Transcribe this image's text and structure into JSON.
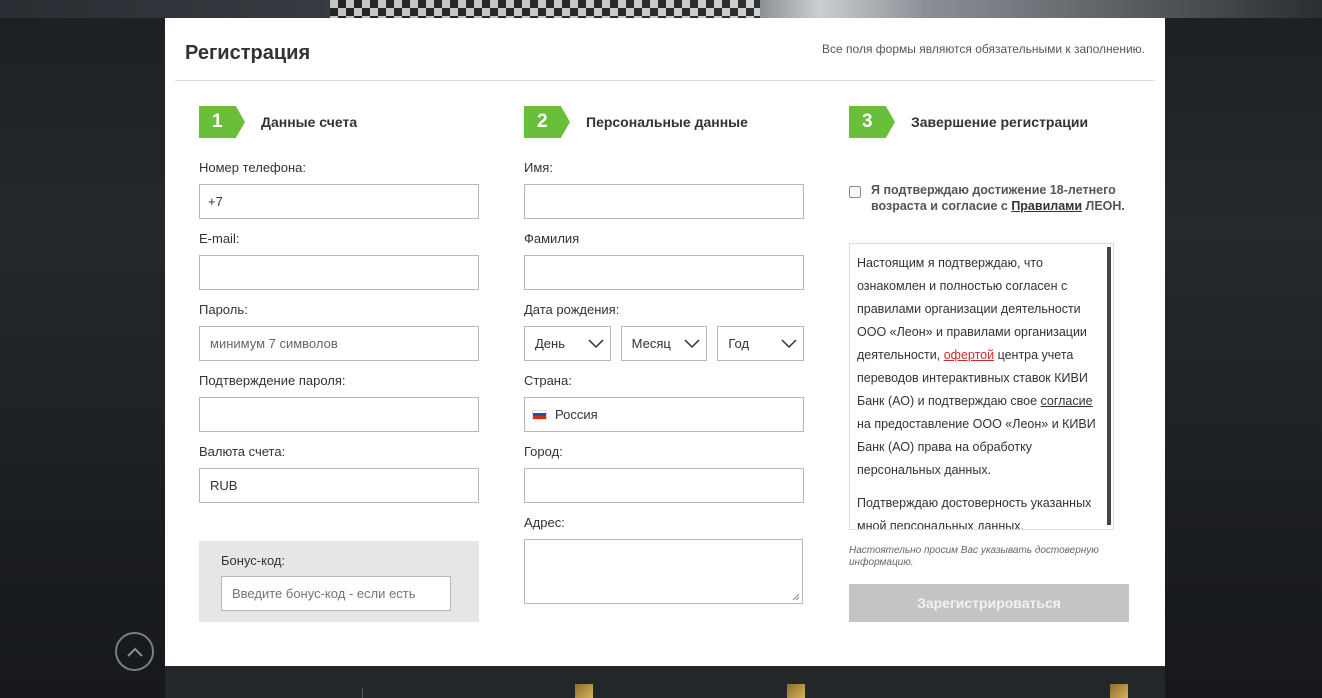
{
  "header": {
    "title": "Регистрация",
    "note": "Все поля формы являются обязательными к заполнению."
  },
  "steps": [
    {
      "number": "1",
      "label": "Данные счета"
    },
    {
      "number": "2",
      "label": "Персональные данные"
    },
    {
      "number": "3",
      "label": "Завершение регистрации"
    }
  ],
  "account": {
    "phone_label": "Номер телефона:",
    "phone_value": "+7",
    "email_label": "E-mail:",
    "password_label": "Пароль:",
    "password_placeholder": "минимум 7 символов",
    "confirm_label": "Подтверждение пароля:",
    "currency_label": "Валюта счета:",
    "currency_value": "RUB",
    "bonus_label": "Бонус-код:",
    "bonus_placeholder": "Введите бонус-код - если есть"
  },
  "personal": {
    "first_name_label": "Имя:",
    "last_name_label": "Фамилия",
    "birth_label": "Дата рождения:",
    "day": "День",
    "month": "Месяц",
    "year": "Год",
    "country_label": "Страна:",
    "country_value": "Россия",
    "city_label": "Город:",
    "address_label": "Адрес:"
  },
  "finish": {
    "agree_text_1": "Я подтверждаю достижение 18-летнего возраста и согласие с ",
    "agree_link": "Правилами",
    "agree_text_2": " ЛЕОН.",
    "terms_p1_a": "Настоящим я подтверждаю, что ознакомлен и полностью согласен с правилами организации деятельности ООО «Леон» и правилами организации деятельности, ",
    "terms_p1_link": "офертой",
    "terms_p1_b": " центра учета переводов интерактивных ставок КИВИ Банк (АО) и подтверждаю свое ",
    "terms_p1_link2": "согласие",
    "terms_p1_c": " на предоставление ООО «Леон» и КИВИ Банк (АО) права на обработку персональных данных.",
    "terms_p2": "Подтверждаю достоверность указанных мной персональных данных.",
    "hint": "Настоятельно просим Вас указывать достоверную информацию.",
    "submit_label": "Зарегистрироваться"
  },
  "colors": {
    "accent_green": "#6abf3a",
    "link_red": "#d12b2b",
    "submit_disabled": "#c4c4c4"
  }
}
